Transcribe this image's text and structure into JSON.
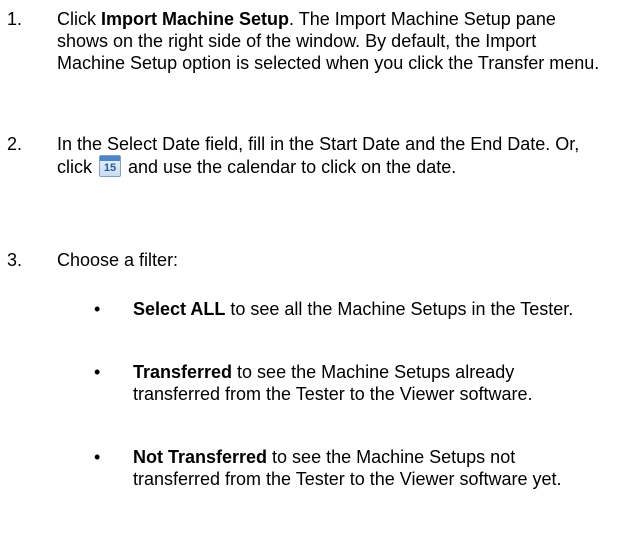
{
  "steps": [
    {
      "number": "1.",
      "bold_text": "Import Machine Setup",
      "lead": "Click ",
      "rest": ". The Import Machine Setup pane shows on the right side of the window. By default, the Import Machine Setup option is selected when you click the Transfer menu."
    },
    {
      "number": "2.",
      "text_before_icon": "In the Select Date field, fill in the Start Date and the End Date. Or, click ",
      "icon": "calendar-icon",
      "icon_label": "15",
      "text_after_icon": " and use the calendar to click on the date."
    },
    {
      "number": "3.",
      "text": "Choose a filter:"
    }
  ],
  "bullets": [
    {
      "marker": "•",
      "bold": "Select ALL",
      "text": " to see all the Machine Setups in the Tester."
    },
    {
      "marker": "•",
      "bold": "Transferred",
      "text": " to see the Machine Setups already transferred from the Tester to the Viewer software."
    },
    {
      "marker": "•",
      "bold": "Not Transferred",
      "text": " to see the Machine Setups not transferred from the Tester to the Viewer software yet."
    }
  ]
}
